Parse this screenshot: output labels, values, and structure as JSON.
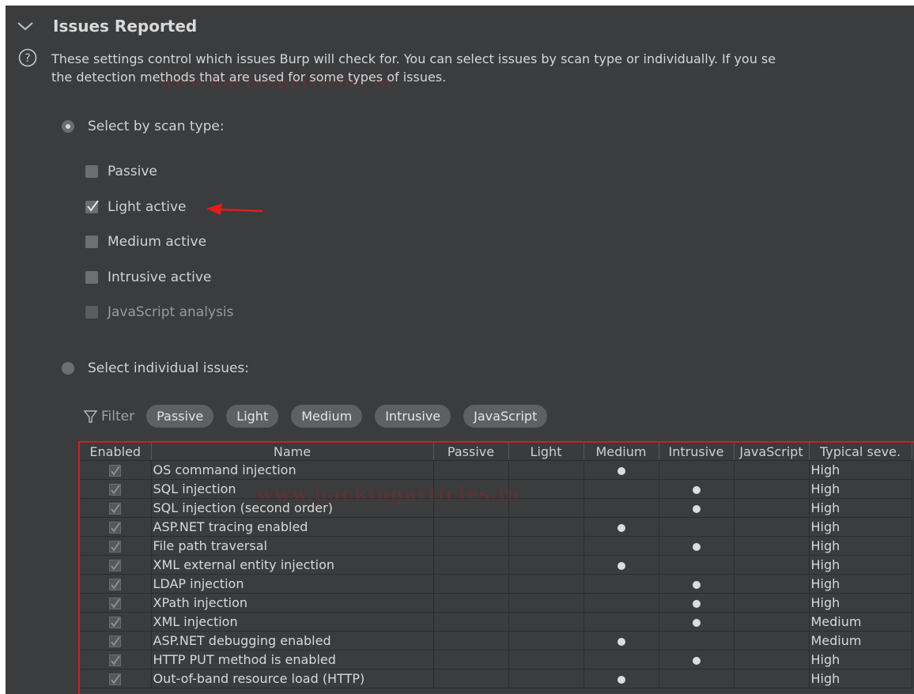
{
  "section": {
    "title": "Issues Reported",
    "description_line1": "These settings control which issues Burp will check for. You can select issues by scan type or individually. If you se",
    "description_line2": "the detection methods that are used for some types of issues."
  },
  "watermark": {
    "text1": "www.hackingarticles.in",
    "text2": "www.hackingarticles.in"
  },
  "scan_type": {
    "label": "Select by scan type:",
    "selected": true,
    "options": [
      {
        "label": "Passive",
        "checked": false
      },
      {
        "label": "Light active",
        "checked": true
      },
      {
        "label": "Medium active",
        "checked": false
      },
      {
        "label": "Intrusive active",
        "checked": false
      },
      {
        "label": "JavaScript analysis",
        "checked": false
      }
    ]
  },
  "individual": {
    "label": "Select individual issues:",
    "selected": false
  },
  "filter": {
    "label": "Filter",
    "chips": [
      "Passive",
      "Light",
      "Medium",
      "Intrusive",
      "JavaScript"
    ]
  },
  "table": {
    "columns": [
      "Enabled",
      "Name",
      "Passive",
      "Light",
      "Medium",
      "Intrusive",
      "JavaScript",
      "Typical seve."
    ],
    "rows": [
      {
        "enabled": true,
        "name": "OS command injection",
        "passive": false,
        "light": false,
        "medium": true,
        "intrusive": false,
        "javascript": false,
        "severity": "High"
      },
      {
        "enabled": true,
        "name": "SQL injection",
        "passive": false,
        "light": false,
        "medium": false,
        "intrusive": true,
        "javascript": false,
        "severity": "High"
      },
      {
        "enabled": true,
        "name": "SQL injection (second order)",
        "passive": false,
        "light": false,
        "medium": false,
        "intrusive": true,
        "javascript": false,
        "severity": "High"
      },
      {
        "enabled": true,
        "name": "ASP.NET tracing enabled",
        "passive": false,
        "light": false,
        "medium": true,
        "intrusive": false,
        "javascript": false,
        "severity": "High"
      },
      {
        "enabled": true,
        "name": "File path traversal",
        "passive": false,
        "light": false,
        "medium": false,
        "intrusive": true,
        "javascript": false,
        "severity": "High"
      },
      {
        "enabled": true,
        "name": "XML external entity injection",
        "passive": false,
        "light": false,
        "medium": true,
        "intrusive": false,
        "javascript": false,
        "severity": "High"
      },
      {
        "enabled": true,
        "name": "LDAP injection",
        "passive": false,
        "light": false,
        "medium": false,
        "intrusive": true,
        "javascript": false,
        "severity": "High"
      },
      {
        "enabled": true,
        "name": "XPath injection",
        "passive": false,
        "light": false,
        "medium": false,
        "intrusive": true,
        "javascript": false,
        "severity": "High"
      },
      {
        "enabled": true,
        "name": "XML injection",
        "passive": false,
        "light": false,
        "medium": false,
        "intrusive": true,
        "javascript": false,
        "severity": "Medium"
      },
      {
        "enabled": true,
        "name": "ASP.NET debugging enabled",
        "passive": false,
        "light": false,
        "medium": true,
        "intrusive": false,
        "javascript": false,
        "severity": "Medium"
      },
      {
        "enabled": true,
        "name": "HTTP PUT method is enabled",
        "passive": false,
        "light": false,
        "medium": false,
        "intrusive": true,
        "javascript": false,
        "severity": "High"
      },
      {
        "enabled": true,
        "name": "Out-of-band resource load (HTTP)",
        "passive": false,
        "light": false,
        "medium": true,
        "intrusive": false,
        "javascript": false,
        "severity": "High"
      }
    ]
  },
  "colors": {
    "panel_background": "#3a3c3e",
    "annotation_red": "#e11d1d"
  },
  "icons": {
    "section_toggle": "chevron-down-icon",
    "help": "question-circle-icon",
    "filter": "funnel-icon",
    "row_enabled": "checkmark-icon",
    "row_flag": "dot-icon"
  }
}
